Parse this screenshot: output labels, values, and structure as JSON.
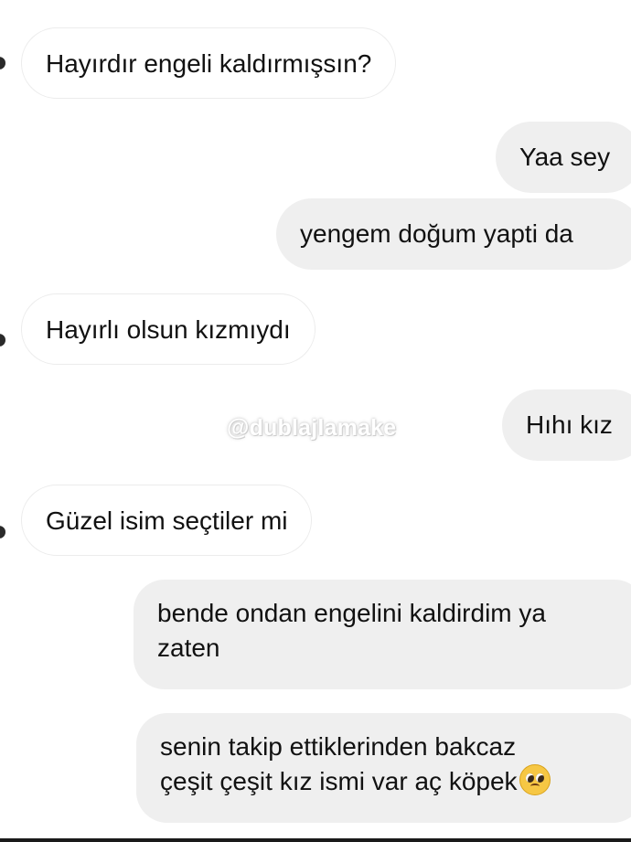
{
  "watermark": "@dublajlamake",
  "messages": [
    {
      "side": "in",
      "text": "Hayırdır engeli kaldırmışsın?"
    },
    {
      "side": "out",
      "text": "Yaa sey"
    },
    {
      "side": "out",
      "text": "yengem doğum yapti da"
    },
    {
      "side": "in",
      "text": "Hayırlı olsun kızmıydı"
    },
    {
      "side": "out",
      "text": "Hıhı kız"
    },
    {
      "side": "in",
      "text": "Güzel isim seçtiler mi"
    },
    {
      "side": "out",
      "line1": "bende ondan engelini kaldirdim ya",
      "line2": "zaten"
    },
    {
      "side": "out",
      "line1": "senin takip ettiklerinden bakcaz",
      "line2": "çeşit çeşit kız ismi var aç köpek",
      "emoji": "pleading-face-emoji"
    }
  ]
}
